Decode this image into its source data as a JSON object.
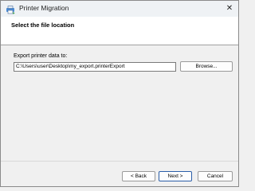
{
  "window": {
    "title": "Printer Migration"
  },
  "header": {
    "title": "Select the file location"
  },
  "export": {
    "label": "Export printer data to:",
    "path": "C:\\Users\\user\\Desktop\\my_export.printerExport",
    "browse_label": "Browse..."
  },
  "footer": {
    "back_label": "< Back",
    "next_label": "Next >",
    "cancel_label": "Cancel"
  }
}
